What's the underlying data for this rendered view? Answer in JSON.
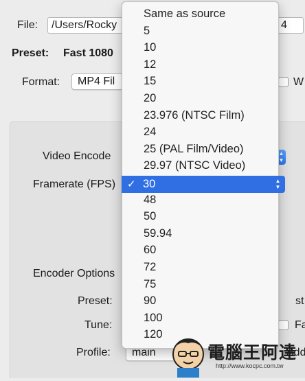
{
  "file": {
    "label": "File:",
    "value": "/Users/Rocky",
    "suffix": "4"
  },
  "preset": {
    "label": "Preset:",
    "value": "Fast 1080"
  },
  "format": {
    "label": "Format:",
    "value": "MP4 Fil",
    "right_letter": "W"
  },
  "video": {
    "encoder_label": "Video Encode",
    "framerate_label": "Framerate (FPS)",
    "encoder_options_label": "Encoder Options",
    "preset_label": "Preset:",
    "preset_right": "st",
    "tune_label": "Tune:",
    "tune_right": "Fa",
    "profile_label": "Profile:",
    "profile_value": "main",
    "profile_right": "Additi"
  },
  "framerate_menu": {
    "items": [
      "Same as source",
      "5",
      "10",
      "12",
      "15",
      "20",
      "23.976 (NTSC Film)",
      "24",
      "25 (PAL Film/Video)",
      "29.97 (NTSC Video)",
      "30",
      "48",
      "50",
      "59.94",
      "60",
      "72",
      "75",
      "90",
      "100",
      "120"
    ],
    "selected": "30",
    "check_glyph": "✓"
  },
  "watermark": {
    "title": "電腦王阿達",
    "url": "http://www.kocpc.com.tw"
  },
  "colors": {
    "accent": "#2f6fe3",
    "window_bg": "#ececec",
    "box_bg": "#e2e2e2"
  }
}
